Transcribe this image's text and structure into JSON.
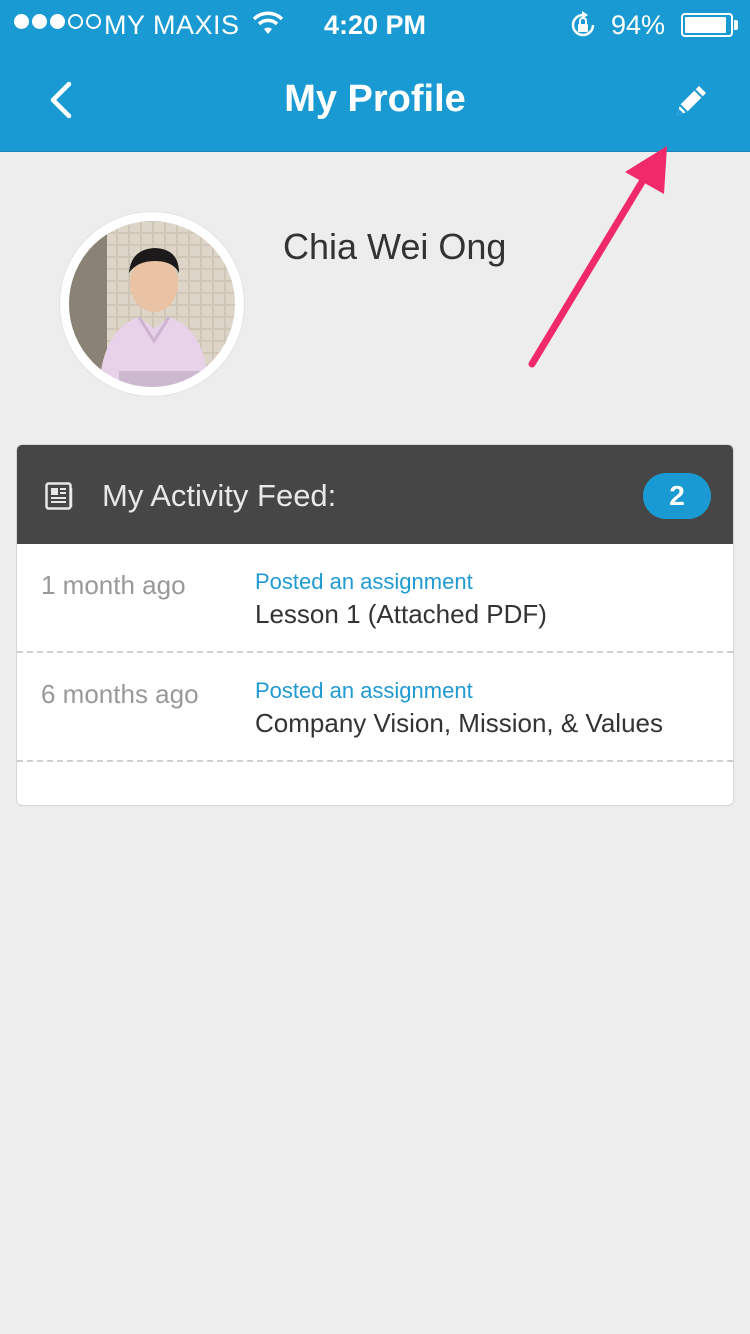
{
  "status_bar": {
    "carrier": "MY MAXIS",
    "time": "4:20 PM",
    "battery_percent": "94%",
    "signal_bars_filled": 3,
    "signal_bars_total": 5,
    "battery_level": 0.94
  },
  "header": {
    "title": "My Profile",
    "back_icon": "chevron-left-icon",
    "edit_icon": "pencil-icon"
  },
  "profile": {
    "name": "Chia Wei Ong"
  },
  "activity_feed": {
    "title": "My Activity Feed:",
    "count": "2",
    "icon": "newspaper-icon",
    "items": [
      {
        "time": "1 month ago",
        "action": "Posted an assignment",
        "detail": "Lesson 1 (Attached PDF)"
      },
      {
        "time": "6 months ago",
        "action": "Posted an assignment",
        "detail": "Company Vision, Mission, & Values"
      }
    ]
  },
  "colors": {
    "accent": "#1a9ad2",
    "feed_header": "#464646",
    "background": "#ededed",
    "annotation_arrow": "#f0296a"
  }
}
